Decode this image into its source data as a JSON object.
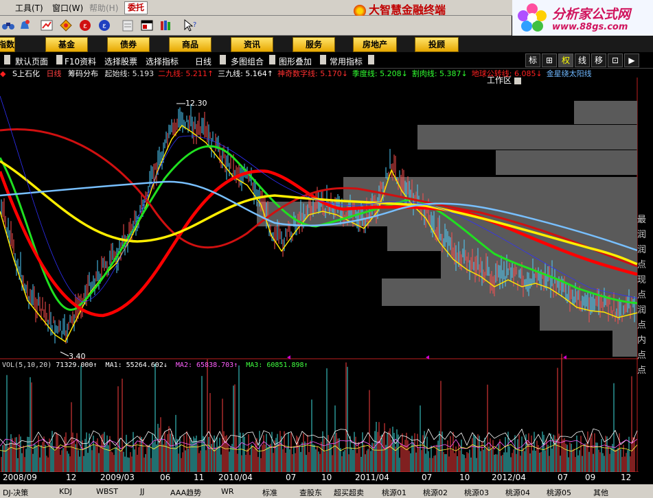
{
  "menu": {
    "items": [
      "工具(T)",
      "窗口(W)",
      "帮助(H)"
    ],
    "disabled_index": 2,
    "trade_button": "委托"
  },
  "app_title": "大智慧金融终端",
  "brand": {
    "name": "分析家公式网",
    "url": "www.88gs.com"
  },
  "toolbar_icons": [
    "binoculars-icon",
    "bell-icon",
    "chart-up-icon",
    "diamond-icon",
    "fire-icon",
    "fire-icon-2",
    "notepad-icon",
    "window-icon",
    "books-icon",
    "pointer-help-icon"
  ],
  "categories": [
    "指数",
    "基金",
    "债券",
    "商品",
    "资讯",
    "服务",
    "房地产",
    "投顾"
  ],
  "workspace_label": "工作区",
  "chart_toolbar": {
    "items": [
      "默认页面",
      "F10资料",
      "选择股票",
      "选择指标",
      "日线",
      "多图组合",
      "图形叠加",
      "常用指标"
    ],
    "right_buttons": [
      "标",
      "⊞",
      "权",
      "线",
      "移",
      "⊡",
      "▶"
    ],
    "active_right": 2
  },
  "legend": {
    "stock": "S上石化",
    "period": "日线",
    "indicator": "筹码分布",
    "lines": [
      {
        "label": "起始线: 5.193",
        "color": "#e0e0e0"
      },
      {
        "label": "二九线: 5.211↑",
        "color": "#ff2020"
      },
      {
        "label": "三九线: 5.164↑",
        "color": "#ffffff"
      },
      {
        "label": "神奇数字线: 5.170↓",
        "color": "#ff3030"
      },
      {
        "label": "季度线: 5.208↓",
        "color": "#30ff30"
      },
      {
        "label": "割肉线: 5.387↓",
        "color": "#30ff30"
      },
      {
        "label": "地球公转线: 6.085↓",
        "color": "#ff2020"
      },
      {
        "label": "金星绕太阳线",
        "color": "#6fb8ff"
      }
    ]
  },
  "price_labels": {
    "high": "12.30",
    "low": "3.40"
  },
  "volume": {
    "title": "VOL(5,10,20)",
    "value": "71329.000↑",
    "ma1": "MA1: 55264.602↓",
    "ma2": "MA2: 65838.703↑",
    "ma3": "MA3: 60851.898↑"
  },
  "side_labels": [
    "最",
    "润",
    "润",
    "点",
    "现",
    "点",
    "润",
    "点",
    "内",
    "点",
    "点"
  ],
  "xaxis": [
    "2008/09",
    "12",
    "2009/03",
    "06",
    "11",
    "2010/04",
    "07",
    "10",
    "2011/04",
    "07",
    "10",
    "2012/04",
    "07",
    "09",
    "12"
  ],
  "bottom_tabs": [
    "DJ-决策",
    "KDJ",
    "WBST",
    "JJ",
    "AAA趋势",
    "WR",
    "标准",
    "查股东",
    "超买超卖",
    "桃源01",
    "桃源02",
    "桃源03",
    "桃源04",
    "桃源05",
    "其他"
  ],
  "colors": {
    "accent": "#ffd200",
    "red_line": "#e01010",
    "yellow_line": "#ffee00",
    "green_line": "#18e018",
    "blue_line": "#78c0ff",
    "volume_up": "#ff4040",
    "volume_down": "#40e0e0"
  }
}
